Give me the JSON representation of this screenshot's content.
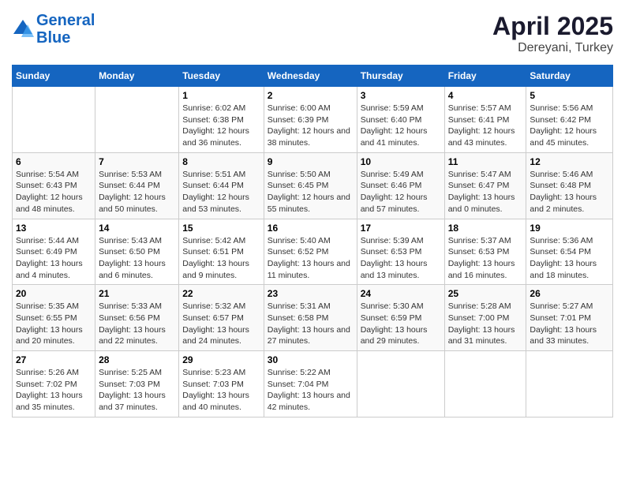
{
  "logo": {
    "line1": "General",
    "line2": "Blue"
  },
  "title": "April 2025",
  "subtitle": "Dereyani, Turkey",
  "weekdays": [
    "Sunday",
    "Monday",
    "Tuesday",
    "Wednesday",
    "Thursday",
    "Friday",
    "Saturday"
  ],
  "weeks": [
    [
      {
        "day": "",
        "sunrise": "",
        "sunset": "",
        "daylight": ""
      },
      {
        "day": "",
        "sunrise": "",
        "sunset": "",
        "daylight": ""
      },
      {
        "day": "1",
        "sunrise": "Sunrise: 6:02 AM",
        "sunset": "Sunset: 6:38 PM",
        "daylight": "Daylight: 12 hours and 36 minutes."
      },
      {
        "day": "2",
        "sunrise": "Sunrise: 6:00 AM",
        "sunset": "Sunset: 6:39 PM",
        "daylight": "Daylight: 12 hours and 38 minutes."
      },
      {
        "day": "3",
        "sunrise": "Sunrise: 5:59 AM",
        "sunset": "Sunset: 6:40 PM",
        "daylight": "Daylight: 12 hours and 41 minutes."
      },
      {
        "day": "4",
        "sunrise": "Sunrise: 5:57 AM",
        "sunset": "Sunset: 6:41 PM",
        "daylight": "Daylight: 12 hours and 43 minutes."
      },
      {
        "day": "5",
        "sunrise": "Sunrise: 5:56 AM",
        "sunset": "Sunset: 6:42 PM",
        "daylight": "Daylight: 12 hours and 45 minutes."
      }
    ],
    [
      {
        "day": "6",
        "sunrise": "Sunrise: 5:54 AM",
        "sunset": "Sunset: 6:43 PM",
        "daylight": "Daylight: 12 hours and 48 minutes."
      },
      {
        "day": "7",
        "sunrise": "Sunrise: 5:53 AM",
        "sunset": "Sunset: 6:44 PM",
        "daylight": "Daylight: 12 hours and 50 minutes."
      },
      {
        "day": "8",
        "sunrise": "Sunrise: 5:51 AM",
        "sunset": "Sunset: 6:44 PM",
        "daylight": "Daylight: 12 hours and 53 minutes."
      },
      {
        "day": "9",
        "sunrise": "Sunrise: 5:50 AM",
        "sunset": "Sunset: 6:45 PM",
        "daylight": "Daylight: 12 hours and 55 minutes."
      },
      {
        "day": "10",
        "sunrise": "Sunrise: 5:49 AM",
        "sunset": "Sunset: 6:46 PM",
        "daylight": "Daylight: 12 hours and 57 minutes."
      },
      {
        "day": "11",
        "sunrise": "Sunrise: 5:47 AM",
        "sunset": "Sunset: 6:47 PM",
        "daylight": "Daylight: 13 hours and 0 minutes."
      },
      {
        "day": "12",
        "sunrise": "Sunrise: 5:46 AM",
        "sunset": "Sunset: 6:48 PM",
        "daylight": "Daylight: 13 hours and 2 minutes."
      }
    ],
    [
      {
        "day": "13",
        "sunrise": "Sunrise: 5:44 AM",
        "sunset": "Sunset: 6:49 PM",
        "daylight": "Daylight: 13 hours and 4 minutes."
      },
      {
        "day": "14",
        "sunrise": "Sunrise: 5:43 AM",
        "sunset": "Sunset: 6:50 PM",
        "daylight": "Daylight: 13 hours and 6 minutes."
      },
      {
        "day": "15",
        "sunrise": "Sunrise: 5:42 AM",
        "sunset": "Sunset: 6:51 PM",
        "daylight": "Daylight: 13 hours and 9 minutes."
      },
      {
        "day": "16",
        "sunrise": "Sunrise: 5:40 AM",
        "sunset": "Sunset: 6:52 PM",
        "daylight": "Daylight: 13 hours and 11 minutes."
      },
      {
        "day": "17",
        "sunrise": "Sunrise: 5:39 AM",
        "sunset": "Sunset: 6:53 PM",
        "daylight": "Daylight: 13 hours and 13 minutes."
      },
      {
        "day": "18",
        "sunrise": "Sunrise: 5:37 AM",
        "sunset": "Sunset: 6:53 PM",
        "daylight": "Daylight: 13 hours and 16 minutes."
      },
      {
        "day": "19",
        "sunrise": "Sunrise: 5:36 AM",
        "sunset": "Sunset: 6:54 PM",
        "daylight": "Daylight: 13 hours and 18 minutes."
      }
    ],
    [
      {
        "day": "20",
        "sunrise": "Sunrise: 5:35 AM",
        "sunset": "Sunset: 6:55 PM",
        "daylight": "Daylight: 13 hours and 20 minutes."
      },
      {
        "day": "21",
        "sunrise": "Sunrise: 5:33 AM",
        "sunset": "Sunset: 6:56 PM",
        "daylight": "Daylight: 13 hours and 22 minutes."
      },
      {
        "day": "22",
        "sunrise": "Sunrise: 5:32 AM",
        "sunset": "Sunset: 6:57 PM",
        "daylight": "Daylight: 13 hours and 24 minutes."
      },
      {
        "day": "23",
        "sunrise": "Sunrise: 5:31 AM",
        "sunset": "Sunset: 6:58 PM",
        "daylight": "Daylight: 13 hours and 27 minutes."
      },
      {
        "day": "24",
        "sunrise": "Sunrise: 5:30 AM",
        "sunset": "Sunset: 6:59 PM",
        "daylight": "Daylight: 13 hours and 29 minutes."
      },
      {
        "day": "25",
        "sunrise": "Sunrise: 5:28 AM",
        "sunset": "Sunset: 7:00 PM",
        "daylight": "Daylight: 13 hours and 31 minutes."
      },
      {
        "day": "26",
        "sunrise": "Sunrise: 5:27 AM",
        "sunset": "Sunset: 7:01 PM",
        "daylight": "Daylight: 13 hours and 33 minutes."
      }
    ],
    [
      {
        "day": "27",
        "sunrise": "Sunrise: 5:26 AM",
        "sunset": "Sunset: 7:02 PM",
        "daylight": "Daylight: 13 hours and 35 minutes."
      },
      {
        "day": "28",
        "sunrise": "Sunrise: 5:25 AM",
        "sunset": "Sunset: 7:03 PM",
        "daylight": "Daylight: 13 hours and 37 minutes."
      },
      {
        "day": "29",
        "sunrise": "Sunrise: 5:23 AM",
        "sunset": "Sunset: 7:03 PM",
        "daylight": "Daylight: 13 hours and 40 minutes."
      },
      {
        "day": "30",
        "sunrise": "Sunrise: 5:22 AM",
        "sunset": "Sunset: 7:04 PM",
        "daylight": "Daylight: 13 hours and 42 minutes."
      },
      {
        "day": "",
        "sunrise": "",
        "sunset": "",
        "daylight": ""
      },
      {
        "day": "",
        "sunrise": "",
        "sunset": "",
        "daylight": ""
      },
      {
        "day": "",
        "sunrise": "",
        "sunset": "",
        "daylight": ""
      }
    ]
  ]
}
